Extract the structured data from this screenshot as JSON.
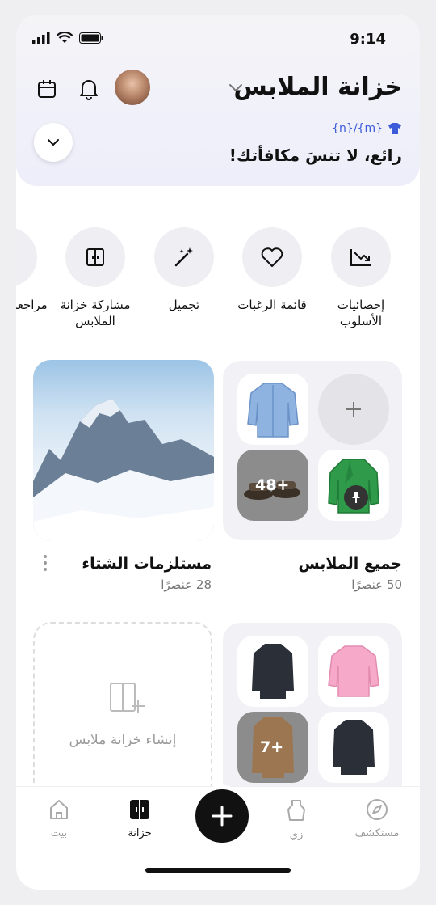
{
  "status": {
    "time": "9:14"
  },
  "header": {
    "title": "خزانة الملابس",
    "reward_code": "{n}/{m}",
    "reward_text": "رائع، لا تنسَ مكافأتك!"
  },
  "actions": [
    {
      "label": "إحصائيات الأسلوب",
      "icon": "style-stats-icon"
    },
    {
      "label": "قائمة الرغبات",
      "icon": "heart-icon"
    },
    {
      "label": "تجميل",
      "icon": "magic-wand-icon"
    },
    {
      "label": "مشاركة خزانة الملابس",
      "icon": "share-wardrobe-icon"
    },
    {
      "label": "مراجعة الملابس",
      "icon": "review-icon"
    }
  ],
  "collections": {
    "all_clothes": {
      "title": "جميع الملابس",
      "count": "50 عنصرًا",
      "more": "48+"
    },
    "winter": {
      "title": "مستلزمات الشتاء",
      "count": "28 عنصرًا"
    },
    "third": {
      "more": "7+"
    }
  },
  "create_wardrobe": {
    "label": "إنشاء خزانة ملابس"
  },
  "tabs": [
    {
      "label": "بيت",
      "icon": "home-icon"
    },
    {
      "label": "خزانة",
      "icon": "wardrobe-icon"
    },
    {
      "label": "زي",
      "icon": "outfit-icon"
    },
    {
      "label": "مستكشف",
      "icon": "compass-icon"
    }
  ],
  "colors": {
    "accent": "#3b5bd9",
    "dark": "#111111"
  }
}
